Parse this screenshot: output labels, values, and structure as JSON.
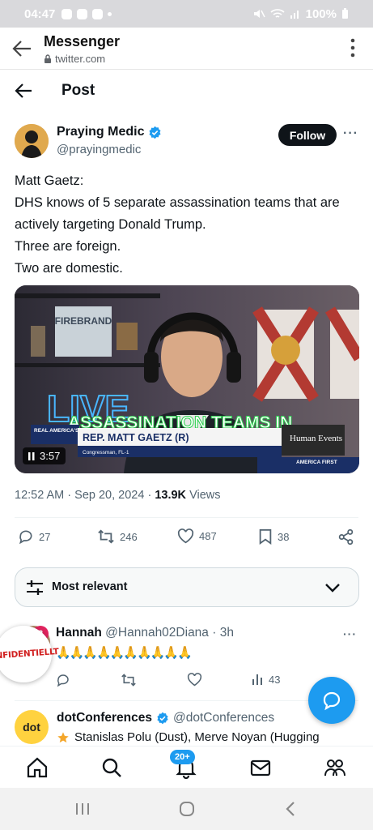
{
  "status_bar": {
    "time": "04:47",
    "battery": "100%"
  },
  "browser": {
    "title": "Messenger",
    "url": "twitter.com"
  },
  "page": {
    "title": "Post"
  },
  "author": {
    "name": "Praying Medic",
    "handle": "@prayingmedic",
    "follow_label": "Follow"
  },
  "tweet": {
    "lines": [
      "Matt Gaetz:",
      "DHS knows of 5 separate assassination teams that are actively targeting Donald Trump.",
      "Three are foreign.",
      "Two are domestic."
    ]
  },
  "media": {
    "duration": "3:57",
    "caption": "ASSASSINATION TEAMS IN",
    "lower_third_name": "REP. MATT GAETZ (R)",
    "lower_third_sub": "Congressman, FL-1",
    "sign": "FIREBRAND",
    "live_text": "LIVE",
    "network": "REAL AMERICA'S VOICE",
    "brand": "Human Events",
    "ticker": "AMERICA FIRST"
  },
  "meta": {
    "time": "12:52 AM",
    "date": "Sep 20, 2024",
    "views": "13.9K",
    "views_label": "Views"
  },
  "actions": {
    "replies": "27",
    "reposts": "246",
    "likes": "487",
    "bookmarks": "38"
  },
  "sort": {
    "label": "Most relevant"
  },
  "replies": [
    {
      "name": "Hannah",
      "handle": "@Hannah02Diana",
      "time": "3h",
      "text": "🙏🙏🙏🙏🙏🙏🙏🙏🙏🙏",
      "views": "43",
      "badge": "2"
    },
    {
      "name": "dotConferences",
      "handle": "@dotConferences",
      "text": "Stanislas Polu (Dust), Merve Noyan (Hugging",
      "avatar_text": "dot"
    }
  ],
  "overlay": {
    "stamp": "ONFIDENTIELLT"
  },
  "tabbar": {
    "notifications_badge": "20+"
  },
  "colors": {
    "accent": "#1d9bf0",
    "text": "#0f1419",
    "muted": "#536471",
    "stamp": "#d11f1f"
  }
}
